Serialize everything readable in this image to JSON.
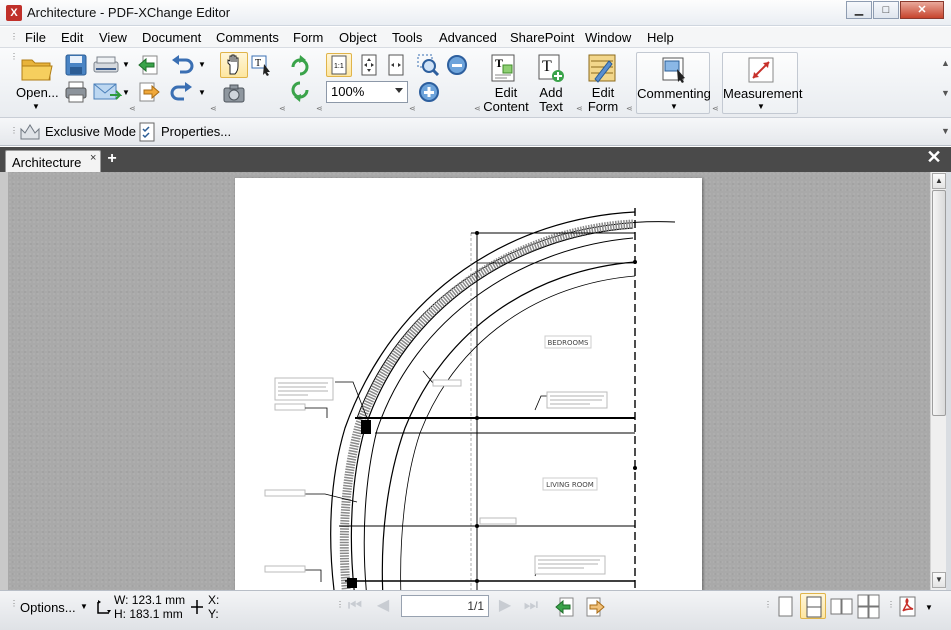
{
  "window": {
    "title": "Architecture - PDF-XChange Editor",
    "controls": {
      "minimize": "▁",
      "maximize": "□",
      "close": "✕"
    }
  },
  "menu": {
    "items": [
      "File",
      "Edit",
      "View",
      "Document",
      "Comments",
      "Form",
      "Object",
      "Tools",
      "Advanced",
      "SharePoint",
      "Window",
      "Help"
    ]
  },
  "toolbar": {
    "open_label": "Open...",
    "zoom_value": "100%",
    "edit_content_label": "Edit\nContent",
    "add_text_label": "Add\nText",
    "edit_form_label": "Edit\nForm",
    "commenting_label": "Commenting",
    "measurement_label": "Measurement"
  },
  "toolbar2": {
    "exclusive_mode_label": "Exclusive Mode",
    "properties_label": "Properties..."
  },
  "tabs": {
    "active_label": "Architecture",
    "close_glyph": "×",
    "add_glyph": "+",
    "close_all_glyph": "✕"
  },
  "drawing": {
    "room_bedrooms": "BEDROOMS",
    "room_living": "LIVING ROOM"
  },
  "status": {
    "options_label": "Options...",
    "width_label": "W: 123.1 mm",
    "height_label": "H: 183.1 mm",
    "x_label": "X:",
    "y_label": "Y:",
    "page_indicator": "1/1"
  },
  "colors": {
    "accent": "#e0b44a",
    "tabbar": "#4a4a4a",
    "viewport": "#a9a9a9"
  }
}
